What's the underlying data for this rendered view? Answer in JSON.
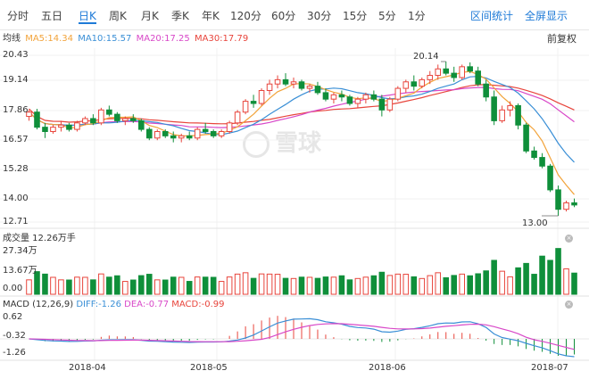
{
  "colors": {
    "up": "#e8453c",
    "down": "#0f8f3a",
    "accent": "#1e7ad7",
    "ma5": "#f2a33a",
    "ma10": "#3a8fd6",
    "ma20": "#d848c8",
    "ma30": "#e8453c"
  },
  "toolbar": {
    "tabs": [
      {
        "label": "分时"
      },
      {
        "label": "五日"
      },
      {
        "label": "日K"
      },
      {
        "label": "周K"
      },
      {
        "label": "月K"
      },
      {
        "label": "季K"
      },
      {
        "label": "年K"
      },
      {
        "label": "120分"
      },
      {
        "label": "60分"
      },
      {
        "label": "30分"
      },
      {
        "label": "15分"
      },
      {
        "label": "5分"
      },
      {
        "label": "1分"
      }
    ],
    "active_tab": "日K",
    "range_stats": "区间统计",
    "fullscreen": "全屏显示"
  },
  "ma": {
    "label": "均线",
    "ma5": "MA5:14.34",
    "ma10": "MA10:15.57",
    "ma20": "MA20:17.25",
    "ma30": "MA30:17.79",
    "adjust": "前复权"
  },
  "price_axis": [
    "20.43",
    "19.14",
    "17.86",
    "16.57",
    "15.28",
    "14.00",
    "12.71"
  ],
  "annotations": {
    "high": "20.14",
    "low": "13.00"
  },
  "volume": {
    "title": "成交量 12.26万手",
    "labels": [
      "27.34万",
      "13.67万",
      "0.00"
    ]
  },
  "macd": {
    "title": "MACD (12,26,9)",
    "diff": "DIFF:-1.26",
    "dea": "DEA:-0.77",
    "macd": "MACD:-0.99",
    "labels": [
      "0.62",
      "-0.32",
      "-1.26"
    ]
  },
  "x_axis": [
    "2018-04",
    "2018-05",
    "2018-06",
    "2018-07"
  ],
  "watermark": "雪球",
  "chart_data": {
    "type": "candlestick",
    "ylim": [
      12.71,
      20.43
    ],
    "candles": [
      [
        17.6,
        17.9,
        17.4,
        17.8
      ],
      [
        17.8,
        17.95,
        17.0,
        17.1
      ],
      [
        17.1,
        17.3,
        16.6,
        16.9
      ],
      [
        16.9,
        17.2,
        16.8,
        17.1
      ],
      [
        17.1,
        17.4,
        16.9,
        17.2
      ],
      [
        17.2,
        17.3,
        16.9,
        17.0
      ],
      [
        17.0,
        17.4,
        16.9,
        17.3
      ],
      [
        17.3,
        17.6,
        17.2,
        17.5
      ],
      [
        17.5,
        17.7,
        17.2,
        17.3
      ],
      [
        17.3,
        18.0,
        17.2,
        17.9
      ],
      [
        17.9,
        18.1,
        17.6,
        17.7
      ],
      [
        17.7,
        17.8,
        17.3,
        17.4
      ],
      [
        17.4,
        17.6,
        17.2,
        17.5
      ],
      [
        17.5,
        17.7,
        17.3,
        17.4
      ],
      [
        17.4,
        17.5,
        16.9,
        17.0
      ],
      [
        17.0,
        17.1,
        16.5,
        16.6
      ],
      [
        16.6,
        17.0,
        16.5,
        16.9
      ],
      [
        16.9,
        17.0,
        16.6,
        16.7
      ],
      [
        16.7,
        16.9,
        16.4,
        16.6
      ],
      [
        16.6,
        16.8,
        16.4,
        16.7
      ],
      [
        16.7,
        16.9,
        16.5,
        16.6
      ],
      [
        16.6,
        17.1,
        16.5,
        17.0
      ],
      [
        17.0,
        17.3,
        16.8,
        16.9
      ],
      [
        16.9,
        17.0,
        16.6,
        16.7
      ],
      [
        16.7,
        17.0,
        16.6,
        16.9
      ],
      [
        16.9,
        17.4,
        16.8,
        17.3
      ],
      [
        17.3,
        17.9,
        17.2,
        17.8
      ],
      [
        17.8,
        18.4,
        17.7,
        18.3
      ],
      [
        18.3,
        18.6,
        18.0,
        18.2
      ],
      [
        18.2,
        18.9,
        18.1,
        18.8
      ],
      [
        18.8,
        19.3,
        18.6,
        19.1
      ],
      [
        19.1,
        19.5,
        18.9,
        19.3
      ],
      [
        19.3,
        19.6,
        19.0,
        19.1
      ],
      [
        19.1,
        19.4,
        18.9,
        19.2
      ],
      [
        19.2,
        19.3,
        18.8,
        18.9
      ],
      [
        18.9,
        19.1,
        18.7,
        19.0
      ],
      [
        19.0,
        19.2,
        18.6,
        18.7
      ],
      [
        18.7,
        18.9,
        18.3,
        18.4
      ],
      [
        18.4,
        18.7,
        18.2,
        18.6
      ],
      [
        18.6,
        18.8,
        18.3,
        18.5
      ],
      [
        18.5,
        18.6,
        18.1,
        18.2
      ],
      [
        18.2,
        18.5,
        18.0,
        18.4
      ],
      [
        18.4,
        18.7,
        18.2,
        18.6
      ],
      [
        18.6,
        18.8,
        18.3,
        18.4
      ],
      [
        18.4,
        18.6,
        17.6,
        17.9
      ],
      [
        17.9,
        18.5,
        17.8,
        18.4
      ],
      [
        18.4,
        19.0,
        18.3,
        18.9
      ],
      [
        18.9,
        19.3,
        18.7,
        19.2
      ],
      [
        19.2,
        19.5,
        18.8,
        19.0
      ],
      [
        19.0,
        19.4,
        18.9,
        19.3
      ],
      [
        19.3,
        19.7,
        19.1,
        19.5
      ],
      [
        19.5,
        20.0,
        19.3,
        19.8
      ],
      [
        19.8,
        20.14,
        19.5,
        19.6
      ],
      [
        19.6,
        19.9,
        19.2,
        19.4
      ],
      [
        19.4,
        20.0,
        19.3,
        19.9
      ],
      [
        19.9,
        20.1,
        19.6,
        19.7
      ],
      [
        19.7,
        19.9,
        19.0,
        19.1
      ],
      [
        19.1,
        19.3,
        18.3,
        18.5
      ],
      [
        18.5,
        18.8,
        17.2,
        17.4
      ],
      [
        17.4,
        18.1,
        17.3,
        17.9
      ],
      [
        17.9,
        18.3,
        17.6,
        18.1
      ],
      [
        18.1,
        18.2,
        17.0,
        17.2
      ],
      [
        17.2,
        17.3,
        15.9,
        16.0
      ],
      [
        16.0,
        16.2,
        15.6,
        15.7
      ],
      [
        15.7,
        15.9,
        15.2,
        15.3
      ],
      [
        15.3,
        15.4,
        14.1,
        14.2
      ],
      [
        14.2,
        14.4,
        13.0,
        13.3
      ],
      [
        13.3,
        13.7,
        13.2,
        13.6
      ],
      [
        13.6,
        13.8,
        13.4,
        13.5
      ]
    ],
    "volume_ylim": [
      0,
      27.34
    ],
    "macd_ylim": [
      -1.26,
      0.62
    ],
    "x_ticks": [
      "2018-04",
      "2018-05",
      "2018-06",
      "2018-07"
    ]
  }
}
